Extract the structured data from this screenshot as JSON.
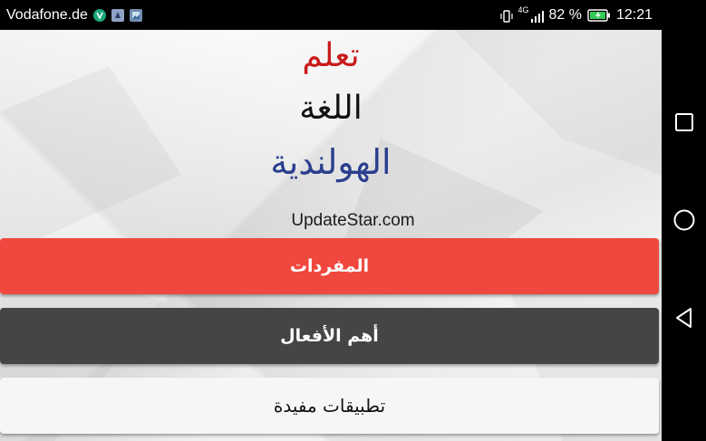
{
  "status_bar": {
    "carrier": "Vodafone.de",
    "network": "4G",
    "battery_percent": "82 %",
    "time": "12:21",
    "icons": [
      "vine-icon",
      "app-notification-icon",
      "image-notification-icon",
      "vibrate-icon",
      "signal-icon",
      "battery-charging-icon"
    ]
  },
  "app": {
    "title_line_1": "تعلم",
    "title_line_2": "اللغة",
    "title_line_3": "الهولندية",
    "site": "UpdateStar.com",
    "buttons": {
      "vocabulary": "المفردات",
      "verbs": "أهم الأفعال",
      "useful_apps": "تطبيقات مفيدة"
    },
    "colors": {
      "title_line_1": "#c91a1a",
      "title_line_3": "#2b3f8f",
      "vocabulary_button": "#f0483e",
      "verbs_button": "#454545",
      "useful_apps_button": "#f6f6f6"
    }
  },
  "nav_bar": {
    "icons": [
      "recent-apps-icon",
      "home-icon",
      "back-icon"
    ]
  }
}
